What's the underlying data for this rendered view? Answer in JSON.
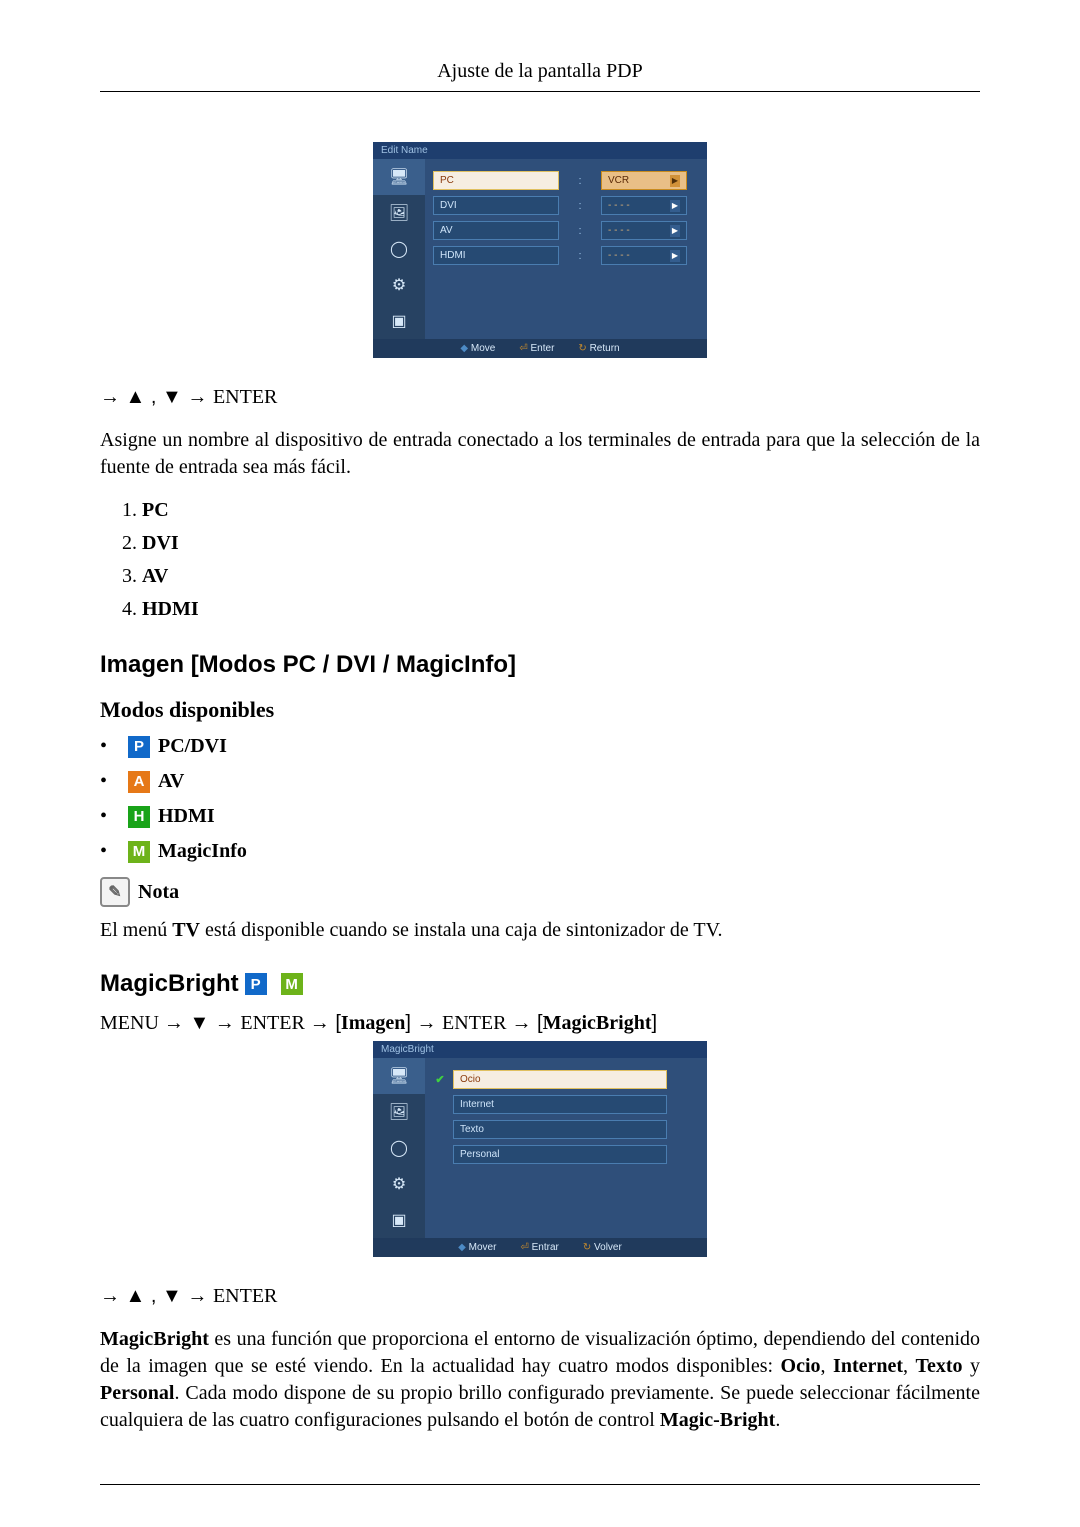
{
  "header": {
    "title": "Ajuste de la pantalla PDP"
  },
  "osd_edit": {
    "title": "Edit Name",
    "rows": [
      {
        "label": "PC",
        "value": "VCR",
        "active": true
      },
      {
        "label": "DVI",
        "value": "- - - -",
        "active": false
      },
      {
        "label": "AV",
        "value": "- - - -",
        "active": false
      },
      {
        "label": "HDMI",
        "value": "- - - -",
        "active": false
      }
    ],
    "help": {
      "move": "Move",
      "enter": "Enter",
      "return": "Return"
    }
  },
  "nav_enter_label": "ENTER",
  "assign_para": "Asigne un nombre al dispositivo de entrada conectado a los terminales de entrada para que la selección de la fuente de entrada sea más fácil.",
  "source_list": [
    {
      "num": "1.",
      "label": "PC"
    },
    {
      "num": "2.",
      "label": "DVI"
    },
    {
      "num": "3.",
      "label": "AV"
    },
    {
      "num": "4.",
      "label": "HDMI"
    }
  ],
  "section_heading": "Imagen [Modos PC / DVI / MagicInfo]",
  "sub_heading": "Modos disponibles",
  "mode_list": [
    {
      "badge": "P",
      "badge_class": "p",
      "label": "PC/DVI"
    },
    {
      "badge": "A",
      "badge_class": "a",
      "label": "AV"
    },
    {
      "badge": "H",
      "badge_class": "h",
      "label": "HDMI"
    },
    {
      "badge": "M",
      "badge_class": "m",
      "label": "MagicInfo"
    }
  ],
  "note": {
    "label": "Nota",
    "text_pre": "El menú ",
    "text_bold": "TV",
    "text_post": " está disponible cuando se instala una caja de sintonizador de TV."
  },
  "magicbright": {
    "heading": "MagicBright",
    "menu_path": {
      "p0": "MENU",
      "p1": "ENTER",
      "p2": "Imagen",
      "p3": "ENTER",
      "p4": "MagicBright"
    },
    "para_pre": "MagicBright",
    "para_mid1": " es una función que proporciona el entorno de visualización óptimo, dependiendo del contenido de la imagen que se esté viendo. En la actualidad hay cuatro modos disponibles: ",
    "modes_b1": "Ocio",
    "comma1": ", ",
    "modes_b2": "Internet",
    "comma2": ", ",
    "modes_b3": "Texto",
    "and": " y ",
    "modes_b4": "Personal",
    "para_mid2": ". Cada modo dispone de su propio brillo configurado previamente. Se puede seleccionar fácilmente cualquiera de las cuatro configuraciones pulsando el botón de control ",
    "mb_bold": "Magic-Bright",
    "para_end": "."
  },
  "osd_mb": {
    "title": "MagicBright",
    "rows": [
      {
        "label": "Ocio",
        "active": true
      },
      {
        "label": "Internet",
        "active": false
      },
      {
        "label": "Texto",
        "active": false
      },
      {
        "label": "Personal",
        "active": false
      }
    ],
    "help": {
      "move": "Mover",
      "enter": "Entrar",
      "return": "Volver"
    }
  }
}
